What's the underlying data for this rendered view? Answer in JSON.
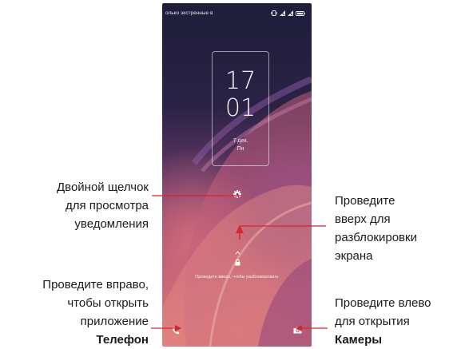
{
  "status_bar": {
    "text": "олько экстренные в",
    "icons": [
      "vibrate-icon",
      "no-signal-icon",
      "no-signal-icon",
      "battery-icon"
    ]
  },
  "lock_screen": {
    "clock_hour": "17",
    "clock_minute": "01",
    "date": "7 дек.",
    "weekday": "Пн",
    "unlock_hint": "Проведите вверх, чтобы разблокировать"
  },
  "callouts": {
    "double_tap": [
      "Двойной щелчок",
      "для просмотра",
      "уведомления"
    ],
    "swipe_up": [
      "Проведите",
      "вверх для",
      "разблокировки",
      "экрана"
    ],
    "swipe_right": [
      "Проведите вправо,",
      "чтобы открыть",
      "приложение",
      "Телефон"
    ],
    "swipe_left": [
      "Проведите влево",
      "для открытия",
      "Камеры"
    ]
  },
  "colors": {
    "callout_line": "#d6262f",
    "text": "#1a1a1a"
  }
}
